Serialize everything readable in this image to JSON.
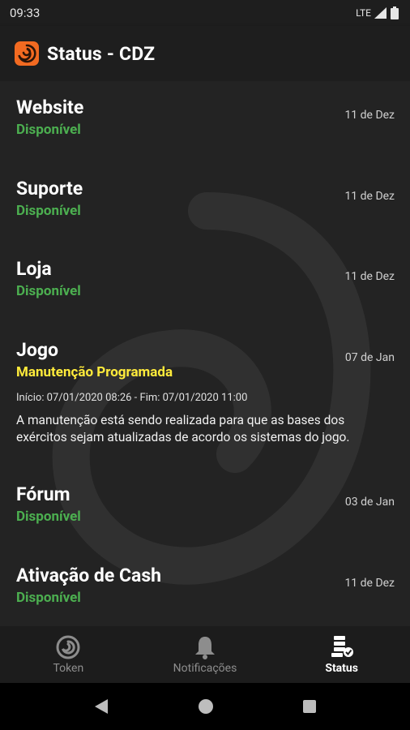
{
  "status_bar": {
    "time": "09:33",
    "network": "LTE"
  },
  "app_bar": {
    "title": "Status - CDZ"
  },
  "services": [
    {
      "name": "Website",
      "date": "11 de Dez",
      "status": "Disponível"
    },
    {
      "name": "Suporte",
      "date": "11 de Dez",
      "status": "Disponível"
    },
    {
      "name": "Loja",
      "date": "11 de Dez",
      "status": "Disponível"
    },
    {
      "name": "Jogo",
      "date": "07 de Jan",
      "status": "Manutenção Programada",
      "period": "Início: 07/01/2020 08:26 - Fim: 07/01/2020 11:00",
      "description": "A manutenção está sendo realizada para que as bases dos exércitos sejam atualizadas de acordo os sistemas do jogo."
    },
    {
      "name": "Fórum",
      "date": "03 de Jan",
      "status": "Disponível"
    },
    {
      "name": "Ativação de Cash",
      "date": "11 de Dez",
      "status": "Disponível"
    }
  ],
  "bottom_nav": [
    {
      "label": "Token",
      "icon": "swirl-icon"
    },
    {
      "label": "Notificações",
      "icon": "bell-icon"
    },
    {
      "label": "Status",
      "icon": "server-status-icon",
      "active": true
    }
  ],
  "colors": {
    "available": "#4caf50",
    "maintenance": "#ffeb3b",
    "brand": "#f26a21"
  }
}
